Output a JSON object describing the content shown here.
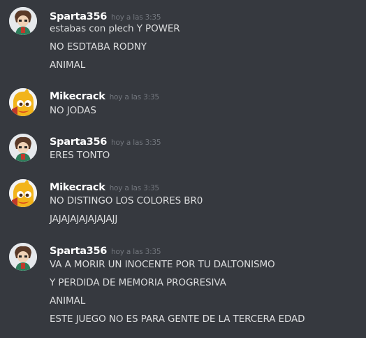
{
  "messages": [
    {
      "author": "Sparta356",
      "timestamp": "hoy a las 3:35",
      "lines": [
        "estabas con plech Y POWER",
        "NO ESDTABA RODNY",
        "ANIMAL"
      ]
    },
    {
      "author": "Mikecrack",
      "timestamp": "hoy a las 3:35",
      "lines": [
        "NO JODAS"
      ]
    },
    {
      "author": "Sparta356",
      "timestamp": "hoy a las 3:35",
      "lines": [
        "ERES TONTO"
      ]
    },
    {
      "author": "Mikecrack",
      "timestamp": "hoy a las 3:35",
      "lines": [
        "NO DISTINGO LOS COLORES BR0",
        "JAJAJAJAJAJAJAJJ"
      ]
    },
    {
      "author": "Sparta356",
      "timestamp": "hoy a las 3:35",
      "lines": [
        "VA A MORIR UN INOCENTE POR TU DALTONISMO",
        "Y PERDIDA DE MEMORIA PROGRESIVA",
        "ANIMAL",
        "ESTE JUEGO NO ES PARA GENTE DE LA TERCERA EDAD"
      ]
    }
  ],
  "avatars": {
    "Sparta356": "sparta-avatar-icon",
    "Mikecrack": "mikecrack-avatar-icon"
  },
  "colors": {
    "background": "#36393f",
    "username": "#ffffff",
    "timestamp": "#72767d",
    "message_text": "#dcddde"
  }
}
